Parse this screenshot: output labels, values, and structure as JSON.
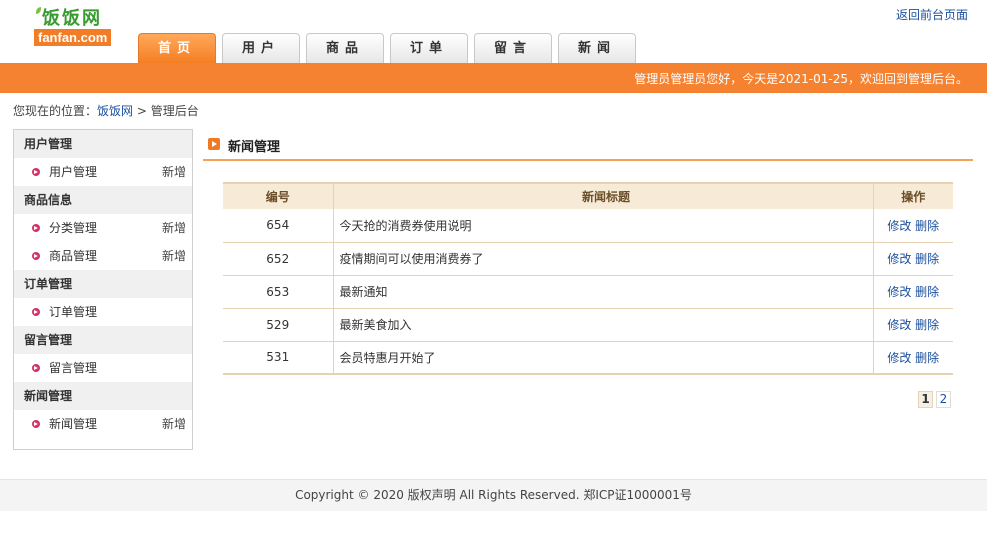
{
  "logo": {
    "cn": "饭饭网",
    "en": "fanfan.com"
  },
  "header": {
    "front_link": "返回前台页面",
    "welcome": "管理员管理员您好，今天是2021-01-25，欢迎回到管理后台。"
  },
  "nav": [
    "首页",
    "用户",
    "商品",
    "订单",
    "留言",
    "新闻"
  ],
  "breadcrumb": {
    "prefix": "您现在的位置：",
    "home": "饭饭网",
    "sep": ">",
    "current": "管理后台"
  },
  "sidebar": {
    "groups": [
      {
        "title": "用户管理",
        "items": [
          {
            "label": "用户管理",
            "add": "新增"
          }
        ]
      },
      {
        "title": "商品信息",
        "items": [
          {
            "label": "分类管理",
            "add": "新增"
          },
          {
            "label": "商品管理",
            "add": "新增"
          }
        ]
      },
      {
        "title": "订单管理",
        "items": [
          {
            "label": "订单管理",
            "add": ""
          }
        ]
      },
      {
        "title": "留言管理",
        "items": [
          {
            "label": "留言管理",
            "add": ""
          }
        ]
      },
      {
        "title": "新闻管理",
        "items": [
          {
            "label": "新闻管理",
            "add": "新增"
          }
        ]
      }
    ]
  },
  "main": {
    "title": "新闻管理",
    "columns": {
      "id": "编号",
      "title": "新闻标题",
      "ops": "操作"
    },
    "rows": [
      {
        "id": "654",
        "title": "今天抢的消费券使用说明"
      },
      {
        "id": "652",
        "title": "疫情期间可以使用消费券了"
      },
      {
        "id": "653",
        "title": "最新通知"
      },
      {
        "id": "529",
        "title": "最新美食加入"
      },
      {
        "id": "531",
        "title": "会员特惠月开始了"
      }
    ],
    "edit_label": "修改",
    "delete_label": "删除",
    "pages": [
      "1",
      "2"
    ],
    "current_page": "1"
  },
  "footer": {
    "copyright": "Copyright © 2020 版权声明 All Rights Reserved. 郑ICP证1000001号"
  }
}
